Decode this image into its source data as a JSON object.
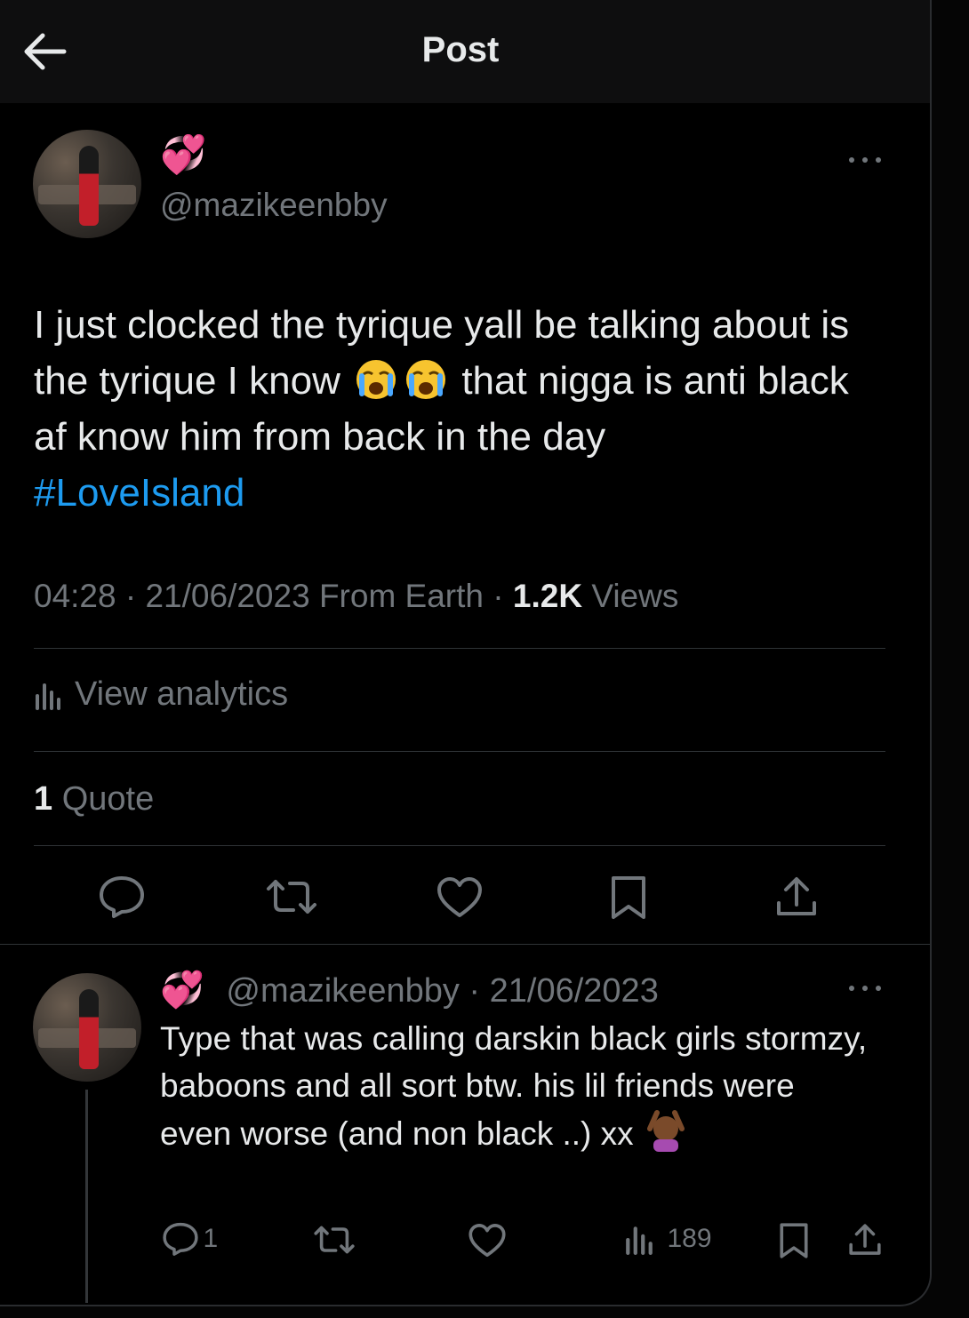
{
  "header": {
    "title": "Post"
  },
  "post": {
    "display_name_emoji": "💞",
    "handle": "@mazikeenbby",
    "text_1": "I just clocked the tyrique yall be talking about is the tyrique I know",
    "text_2": "that nigga is anti black af know him from back in the day",
    "hashtag": "#LoveIsland",
    "time": "04:28",
    "date": "21/06/2023",
    "source": "From Earth",
    "views_count": "1.2K",
    "views_label": "Views",
    "analytics_label": "View analytics",
    "quote_count": "1",
    "quote_label": "Quote"
  },
  "reply": {
    "display_name_emoji": "💞",
    "handle": "@mazikeenbby",
    "date": "21/06/2023",
    "text": "Type that was calling darskin black girls stormzy, baboons and all sort btw. his lil friends were even worse (and non black ..) xx",
    "reply_count": "1",
    "views_count": "189"
  },
  "colors": {
    "accent": "#1d9bf0",
    "muted": "#71767b",
    "heart": "#f91880"
  },
  "icons": [
    "back-arrow-icon",
    "more-icon",
    "reply-icon",
    "repost-icon",
    "like-icon",
    "bookmark-icon",
    "share-icon",
    "analytics-icon",
    "crying-face-emoji",
    "no-gesture-emoji"
  ]
}
